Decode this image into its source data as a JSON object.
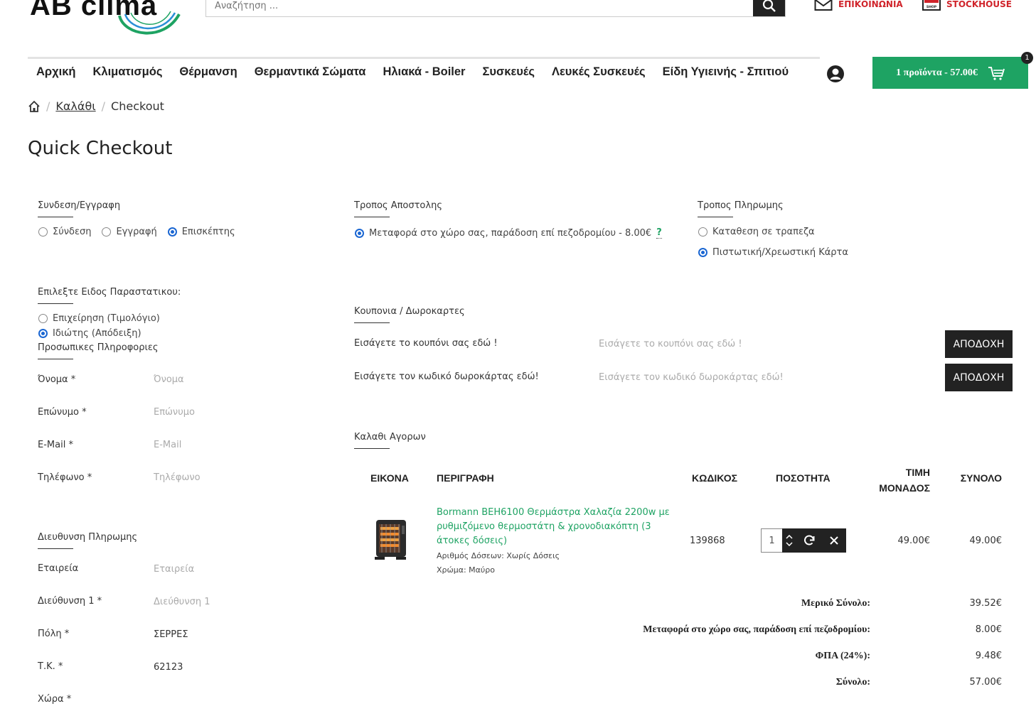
{
  "header": {
    "logo_text": "AB clima",
    "search_placeholder": "Αναζήτηση ...",
    "contact_label": "ΕΠΙΚΟΙΝΩΝΙΑ",
    "stockhouse_label": "STOCKHOUSE",
    "shop_icon_text": "SHOP"
  },
  "nav": {
    "items": [
      "Αρχική",
      "Κλιματισμός",
      "Θέρμανση",
      "Θερμαντικά Σώματα",
      "Ηλιακά - Boiler",
      "Συσκευές",
      "Λευκές Συσκευές",
      "Είδη Υγιεινής - Σπιτιού"
    ],
    "cart_label": "1 προϊόντα - 57.00€",
    "cart_badge": "1"
  },
  "breadcrumb": {
    "cart": "Καλάθι",
    "separator": "/",
    "current": "Checkout"
  },
  "page_title": "Quick Checkout",
  "login": {
    "title": "Συνδεση/Εγγραφη",
    "options": [
      {
        "label": "Σύνδεση",
        "selected": false
      },
      {
        "label": "Εγγραφή",
        "selected": false
      },
      {
        "label": "Επισκέπτης",
        "selected": true
      }
    ]
  },
  "receipt": {
    "title": "Επιλεξτε Ειδος Παραστατικου:",
    "options": [
      {
        "label": "Επιχείρηση (Τιμολόγιο)",
        "selected": false
      },
      {
        "label": "Ιδιώτης (Απόδειξη)",
        "selected": true
      }
    ]
  },
  "personal": {
    "title": "Προσωπικες Πληροφοριες",
    "fields": [
      {
        "label": "Όνομα *",
        "placeholder": "Όνομα",
        "value": ""
      },
      {
        "label": "Επώνυμο *",
        "placeholder": "Επώνυμο",
        "value": ""
      },
      {
        "label": "E-Mail *",
        "placeholder": "E-Mail",
        "value": ""
      },
      {
        "label": "Τηλέφωνο *",
        "placeholder": "Τηλέφωνο",
        "value": ""
      }
    ]
  },
  "payment_address": {
    "title": "Διευθυνση Πληρωμης",
    "fields": [
      {
        "label": "Εταιρεία",
        "placeholder": "Εταιρεία",
        "value": ""
      },
      {
        "label": "Διεύθυνση 1 *",
        "placeholder": "Διεύθυνση 1",
        "value": ""
      },
      {
        "label": "Πόλη *",
        "placeholder": "",
        "value": "ΣΕΡΡΕΣ"
      },
      {
        "label": "Τ.Κ. *",
        "placeholder": "",
        "value": "62123"
      },
      {
        "label": "Χώρα *",
        "placeholder": "",
        "value": ""
      }
    ]
  },
  "shipping": {
    "title": "Τροπος Αποστολης",
    "option": "Μεταφορά στο χώρο σας, παράδοση επί πεζοδρομίου - 8.00€",
    "help": "?"
  },
  "payment": {
    "title": "Τροπος Πληρωμης",
    "options": [
      {
        "label": "Καταθεση σε τραπεζα",
        "selected": false
      },
      {
        "label": "Πιστωτική/Χρεωστική Κάρτα",
        "selected": true
      }
    ]
  },
  "coupons": {
    "title": "Κουπονια / Δωροκαρτες",
    "coupon_label": "Εισάγετε το κουπόνι σας εδώ !",
    "coupon_placeholder": "Εισάγετε το κουπόνι σας εδώ !",
    "voucher_label": "Εισάγετε τον κωδικό δωροκάρτας εδώ!",
    "voucher_placeholder": "Εισάγετε τον κωδικό δωροκάρτας εδώ!",
    "accept_label": "ΑΠΟΔΟΧΗ"
  },
  "cart": {
    "title": "Καλαθι Αγορων",
    "columns": {
      "image": "ΕΙΚΟΝΑ",
      "description": "ΠΕΡΙΓΡΑΦΗ",
      "code": "ΚΩΔΙΚΟΣ",
      "quantity": "ΠΟΣΟΤΗΤΑ",
      "unit_price_1": "ΤΙΜΗ",
      "unit_price_2": "ΜΟΝΑΔΟΣ",
      "total": "ΣΥΝΟΛΟ"
    },
    "item": {
      "name": "Bormann BEH6100 Θερμάστρα Χαλαζία 2200w με ρυθμιζόμενο θερμοστάτη & χρονοδιακόπτη (3 άτοκες δόσεις)",
      "option_1": "Αριθμός Δόσεων: Χωρίς Δόσεις",
      "option_2": "Χρώμα: Μαύρο",
      "code": "139868",
      "quantity": "1",
      "unit_price": "49.00€",
      "total": "49.00€"
    },
    "totals": [
      {
        "label": "Μερικό Σύνολο:",
        "value": "39.52€"
      },
      {
        "label": "Μεταφορά στο χώρο σας, παράδοση επί πεζοδρομίου:",
        "value": "8.00€"
      },
      {
        "label": "ΦΠΑ (24%):",
        "value": "9.48€"
      },
      {
        "label": "Σύνολο:",
        "value": "57.00€"
      }
    ]
  },
  "colors": {
    "accent_green": "#1ea363",
    "brand_red": "#d0242b",
    "radio_blue": "#1a66d2",
    "dark": "#222222"
  }
}
